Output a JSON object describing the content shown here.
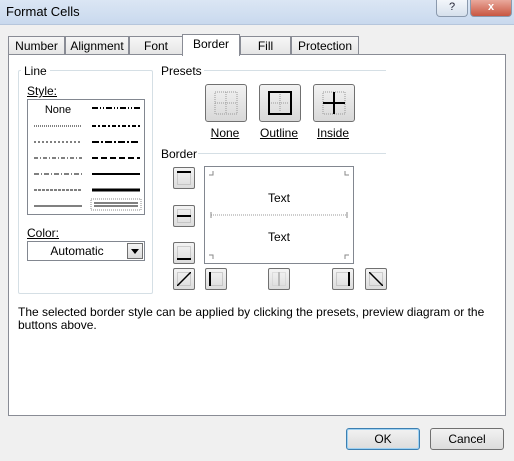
{
  "window": {
    "title": "Format Cells",
    "help_label": "?",
    "close_label": "x"
  },
  "tabs": [
    {
      "label": "Number"
    },
    {
      "label": "Alignment"
    },
    {
      "label": "Font"
    },
    {
      "label": "Border",
      "active": true
    },
    {
      "label": "Fill"
    },
    {
      "label": "Protection"
    }
  ],
  "line": {
    "group_label": "Line",
    "style_label": "Style:",
    "style_none": "None",
    "color_label": "Color:",
    "color_value": "Automatic"
  },
  "presets": {
    "group_label": "Presets",
    "none_label": "None",
    "outline_label": "Outline",
    "inside_label": "Inside"
  },
  "border": {
    "group_label": "Border",
    "preview_text_top": "Text",
    "preview_text_bottom": "Text"
  },
  "info_text": "The selected border style can be applied by clicking the presets, preview diagram or the buttons above.",
  "buttons": {
    "ok": "OK",
    "cancel": "Cancel"
  }
}
